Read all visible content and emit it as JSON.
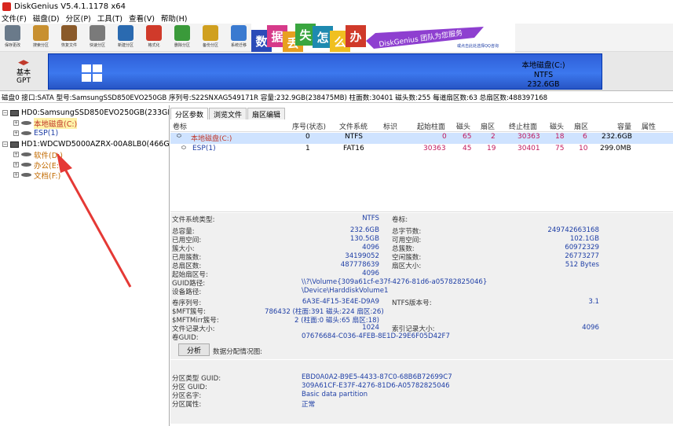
{
  "window": {
    "title": "DiskGenius V5.4.1.1178 x64"
  },
  "menu": [
    "文件(F)",
    "磁盘(D)",
    "分区(P)",
    "工具(T)",
    "查看(V)",
    "帮助(H)"
  ],
  "toolbar": [
    {
      "icon": "save-icon",
      "label": "保存更改",
      "color": "#6a7a8a"
    },
    {
      "icon": "search-icon",
      "label": "搜索分区",
      "color": "#c89030"
    },
    {
      "icon": "recover-files-icon",
      "label": "恢复文件",
      "color": "#8a5a2a"
    },
    {
      "icon": "quick-partition-icon",
      "label": "快速分区",
      "color": "#7a7a7a"
    },
    {
      "icon": "new-partition-icon",
      "label": "新建分区",
      "color": "#2a6ab0"
    },
    {
      "icon": "format-icon",
      "label": "格式化",
      "color": "#d03a2a"
    },
    {
      "icon": "delete-partition-icon",
      "label": "删除分区",
      "color": "#3a9a3a"
    },
    {
      "icon": "backup-partition-icon",
      "label": "备份分区",
      "color": "#d0a020"
    },
    {
      "icon": "system-migrate-icon",
      "label": "系统迁移",
      "color": "#3a7ad0"
    }
  ],
  "banner": {
    "chars": [
      "数",
      "据",
      "丢",
      "失",
      "怎",
      "么",
      "办"
    ],
    "char_colors": [
      "#2b4bb8",
      "#d63a8a",
      "#e8a020",
      "#3aa640",
      "#1e8ab0",
      "#f0c020",
      "#d03a2a"
    ],
    "slogan": "DiskGenius 团队为您服务",
    "subtext": "或点击此处选择QQ咨询",
    "accent": "#8e3fd0"
  },
  "diskmap": {
    "nav_label": "基本",
    "nav_sub": "GPT",
    "partition_name": "本地磁盘(C:)",
    "partition_fs": "NTFS",
    "partition_size": "232.6GB",
    "bar_color": "#3c78ee"
  },
  "diskinfo": "磁盘0 接口:SATA  型号:SamsungSSD850EVO250GB  序列号:S22SNXAG549171R  容量:232.9GB(238475MB)  柱面数:30401  磁头数:255  每道扇区数:63  总扇区数:488397168",
  "tree": {
    "hd0": "HD0:SamsungSSD850EVO250GB(233GB)",
    "hd0_parts": [
      "本地磁盘(C:)",
      "ESP(1)"
    ],
    "hd1": "HD1:WDCWD5000AZRX-00A8LB0(466GB)",
    "hd1_parts": [
      "软件(D:)",
      "办公(E:)",
      "文档(F:)"
    ]
  },
  "tabs": [
    "分区参数",
    "浏览文件",
    "扇区编辑"
  ],
  "table": {
    "headers": [
      "卷标",
      "序号(状态)",
      "文件系统",
      "标识",
      "起始柱面",
      "磁头",
      "扇区",
      "终止柱面",
      "磁头",
      "扇区",
      "容量",
      "属性"
    ],
    "rows": [
      [
        "本地磁盘(C:)",
        "0",
        "NTFS",
        "",
        "0",
        "65",
        "2",
        "30363",
        "18",
        "6",
        "232.6GB",
        ""
      ],
      [
        "ESP(1)",
        "1",
        "FAT16",
        "",
        "30363",
        "45",
        "19",
        "30401",
        "75",
        "10",
        "299.0MB",
        ""
      ]
    ]
  },
  "fsinfo": {
    "fs_type_label": "文件系统类型:",
    "fs_type": "NTFS",
    "volume_label": "卷标:",
    "rows_left": [
      [
        "总容量:",
        "232.6GB"
      ],
      [
        "已用空间:",
        "130.5GB"
      ],
      [
        "簇大小:",
        "4096"
      ],
      [
        "已用簇数:",
        "34199052"
      ],
      [
        "总扇区数:",
        "487778639"
      ],
      [
        "起始扇区号:",
        "4096"
      ]
    ],
    "rows_right": [
      [
        "总字节数:",
        "249742663168"
      ],
      [
        "可用空间:",
        "102.1GB"
      ],
      [
        "总簇数:",
        "60972329"
      ],
      [
        "空闲簇数:",
        "26773277"
      ],
      [
        "扇区大小:",
        "512 Bytes"
      ]
    ],
    "guid_path_label": "GUID路径:",
    "guid_path": "\\\\?\\Volume{309a61cf-e37f-4276-81d6-a05782825046}",
    "device_path_label": "设备路径:",
    "device_path": "\\Device\\HarddiskVolume1",
    "serial_label": "卷序列号:",
    "serial": "6A3E-4F15-3E4E-D9A9",
    "ntfs_ver_label": "NTFS版本号:",
    "ntfs_ver": "3.1",
    "mft_label": "$MFT簇号:",
    "mft": "786432 (柱面:391 磁头:224 扇区:26)",
    "mftmirr_label": "$MFTMirr簇号:",
    "mftmirr": "2 (柱面:0 磁头:65 扇区:18)",
    "filerec_label": "文件记录大小:",
    "filerec": "1024",
    "indexrec_label": "索引记录大小:",
    "indexrec": "4096",
    "volguid_label": "卷GUID:",
    "volguid": "07676684-C036-4FEB-8E1D-29E6F05D42F7"
  },
  "analyze": {
    "button": "分析",
    "text": "数据分配情况图:"
  },
  "partinfo": {
    "type_guid_label": "分区类型 GUID:",
    "type_guid": "EBD0A0A2-B9E5-4433-87C0-68B6B72699C7",
    "part_guid_label": "分区 GUID:",
    "part_guid": "309A61CF-E37F-4276-81D6-A05782825046",
    "name_label": "分区名字:",
    "name": "Basic data partition",
    "attr_label": "分区属性:",
    "attr": "正常"
  }
}
